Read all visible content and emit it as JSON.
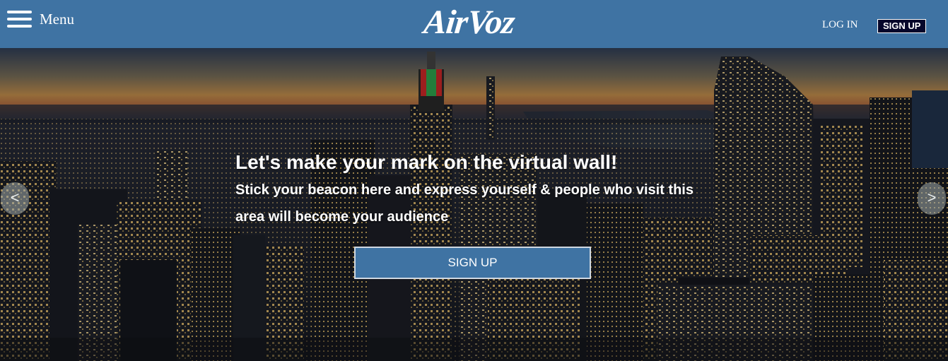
{
  "header": {
    "menu_label": "Menu",
    "logo_text": "AirVoz",
    "login_label": "LOG IN",
    "signup_label": "SIGN UP"
  },
  "hero": {
    "title": "Let's make your mark on the virtual wall!",
    "subtitle": "Stick your beacon here and express yourself & people who visit this area will become your audience",
    "signup_label": "SIGN UP",
    "prev_arrow": "<",
    "next_arrow": ">"
  },
  "icons": {
    "menu": "hamburger-icon"
  },
  "colors": {
    "header_bg": "#3f73a3",
    "button_bg": "#3f73a3",
    "top_signup_bg": "#06062a"
  }
}
